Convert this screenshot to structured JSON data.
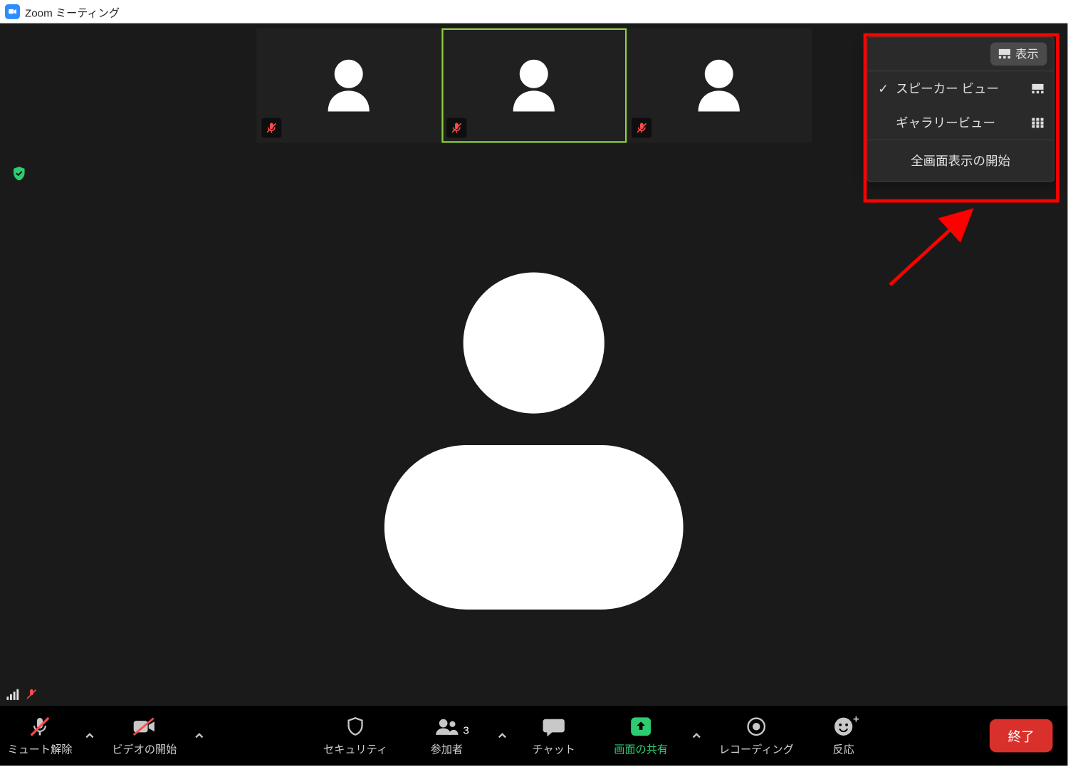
{
  "window": {
    "title": "Zoom ミーティング"
  },
  "thumbnails": [
    {
      "muted": true,
      "active": false
    },
    {
      "muted": true,
      "active": true
    },
    {
      "muted": true,
      "active": false
    }
  ],
  "viewPanel": {
    "toggleLabel": "表示",
    "options": [
      {
        "label": "スピーカー ビュー",
        "checked": true
      },
      {
        "label": "ギャラリービュー",
        "checked": false
      }
    ],
    "fullscreenLabel": "全画面表示の開始"
  },
  "toolbar": {
    "mute": "ミュート解除",
    "video": "ビデオの開始",
    "security": "セキュリティ",
    "participantsLabel": "参加者",
    "participantsCount": "3",
    "chat": "チャット",
    "share": "画面の共有",
    "record": "レコーディング",
    "reactions": "反応",
    "end": "終了"
  }
}
